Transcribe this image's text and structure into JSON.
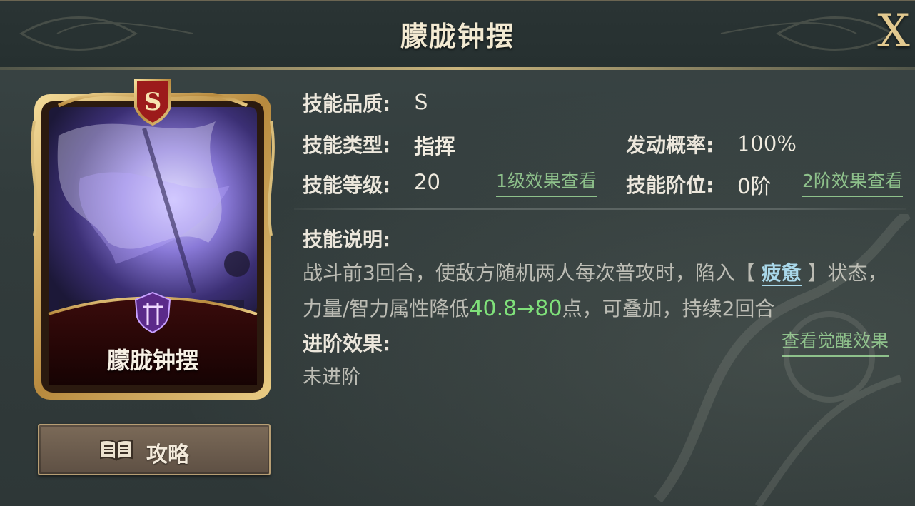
{
  "header": {
    "title": "朦胧钟摆",
    "close_label": "X"
  },
  "card": {
    "grade_badge": "S",
    "name": "朦胧钟摆",
    "emblem_icon": "sword-shield-icon"
  },
  "guide_button": {
    "label": "攻略",
    "icon": "book-icon"
  },
  "info": {
    "quality_label": "技能品质:",
    "quality_value": "S",
    "type_label": "技能类型:",
    "type_value": "指挥",
    "chance_label": "发动概率:",
    "chance_value": "100%",
    "level_label": "技能等级:",
    "level_value": "20",
    "level_link": "1级效果查看",
    "rank_label": "技能阶位:",
    "rank_value": "0阶",
    "rank_link": "2阶效果查看"
  },
  "description": {
    "label": "技能说明:",
    "text_part1": "战斗前3回合，使敌方随机两人每次普攻时，陷入【 ",
    "keyword": "疲惫",
    "text_part2": " 】状态，力量/智力属性降低",
    "value_from": "40.8",
    "arrow": "→",
    "value_to": "80",
    "text_part3": "点，可叠加，持续2回合"
  },
  "advance": {
    "label": "进阶效果:",
    "link": "查看觉醒效果",
    "status": "未进阶"
  },
  "colors": {
    "accent_gold": "#c9b47c",
    "link_green": "#8ec18b",
    "value_green": "#7fe07a",
    "keyword_blue": "#a9d8ea"
  }
}
